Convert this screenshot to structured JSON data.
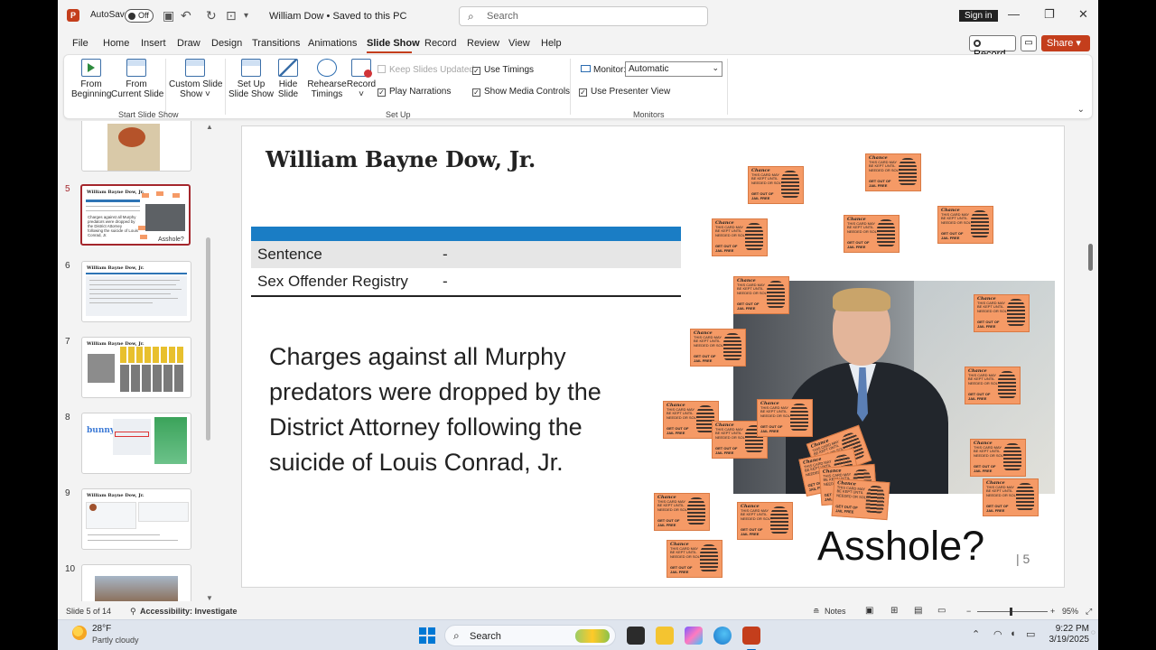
{
  "titlebar": {
    "app_logo": "P",
    "autosave_label": "AutoSave",
    "autosave_state": "Off",
    "filename": "William Dow • Saved to this PC",
    "search_placeholder": "Search",
    "signin_label": "Sign in",
    "icons": [
      "save-icon",
      "undo-icon",
      "redo-icon",
      "customize-icon"
    ]
  },
  "menu": {
    "tabs": [
      "File",
      "Home",
      "Insert",
      "Draw",
      "Design",
      "Transitions",
      "Animations",
      "Slide Show",
      "Record",
      "Review",
      "View",
      "Help"
    ],
    "active_tab": "Slide Show",
    "record_label": "Record",
    "share_label": "Share"
  },
  "ribbon": {
    "from_beginning": "From\nBeginning",
    "from_current": "From\nCurrent Slide",
    "custom_show": "Custom Slide\nShow ˅",
    "setup_show": "Set Up\nSlide Show",
    "hide_slide": "Hide\nSlide",
    "rehearse": "Rehearse\nTimings",
    "record": "Record\n˅",
    "keep_updated": "Keep Slides Updated",
    "play_narrations": "Play Narrations",
    "use_timings": "Use Timings",
    "show_media_controls": "Show Media Controls",
    "monitor_label": "Monitor:",
    "monitor_value": "Automatic",
    "presenter_view": "Use Presenter View",
    "group_start": "Start Slide Show",
    "group_setup": "Set Up",
    "group_monitors": "Monitors"
  },
  "thumbnails": {
    "numbers": [
      "5",
      "6",
      "7",
      "8",
      "9",
      "10"
    ],
    "slide5_title": "William Bayne Dow, Jr.",
    "slide5_text": "Charges against all Murphy predators were dropped by the District Attorney following the suicide of Louis Conrad, Jr.",
    "slide5_caption": "Asshole?",
    "slide6_title": "William Bayne Dow, Jr.",
    "slide7_title": "William Bayne Dow, Jr.",
    "slide8_title": "bunny",
    "slide9_title": "William Bayne Dow, Jr."
  },
  "slide": {
    "title": "William Bayne Dow, Jr.",
    "table": [
      {
        "label": "Sentence",
        "value": "-"
      },
      {
        "label": "Sex Offender Registry",
        "value": "-"
      }
    ],
    "body": "Charges against all Murphy predators were dropped by the District Attorney following the suicide of Louis Conrad, Jr.",
    "caption": "Asshole?",
    "number": "| 5",
    "card_chance": "Chance",
    "card_text": "THIS CARD MAY BE KEPT UNTIL NEEDED OR SOLD",
    "card_jail": "GET OUT OF JAIL FREE"
  },
  "status": {
    "slide_of": "Slide 5 of 14",
    "accessibility": "Accessibility: Investigate",
    "notes": "Notes",
    "zoom": "95%"
  },
  "taskbar": {
    "temp": "28°F",
    "weather": "Partly cloudy",
    "search": "Search",
    "time": "9:22 PM",
    "date": "3/19/2025"
  },
  "colors": {
    "accent": "#c43e1c",
    "table_header": "#1a7dc5",
    "card": "#f59a66",
    "active_thumb": "#a4262c"
  }
}
